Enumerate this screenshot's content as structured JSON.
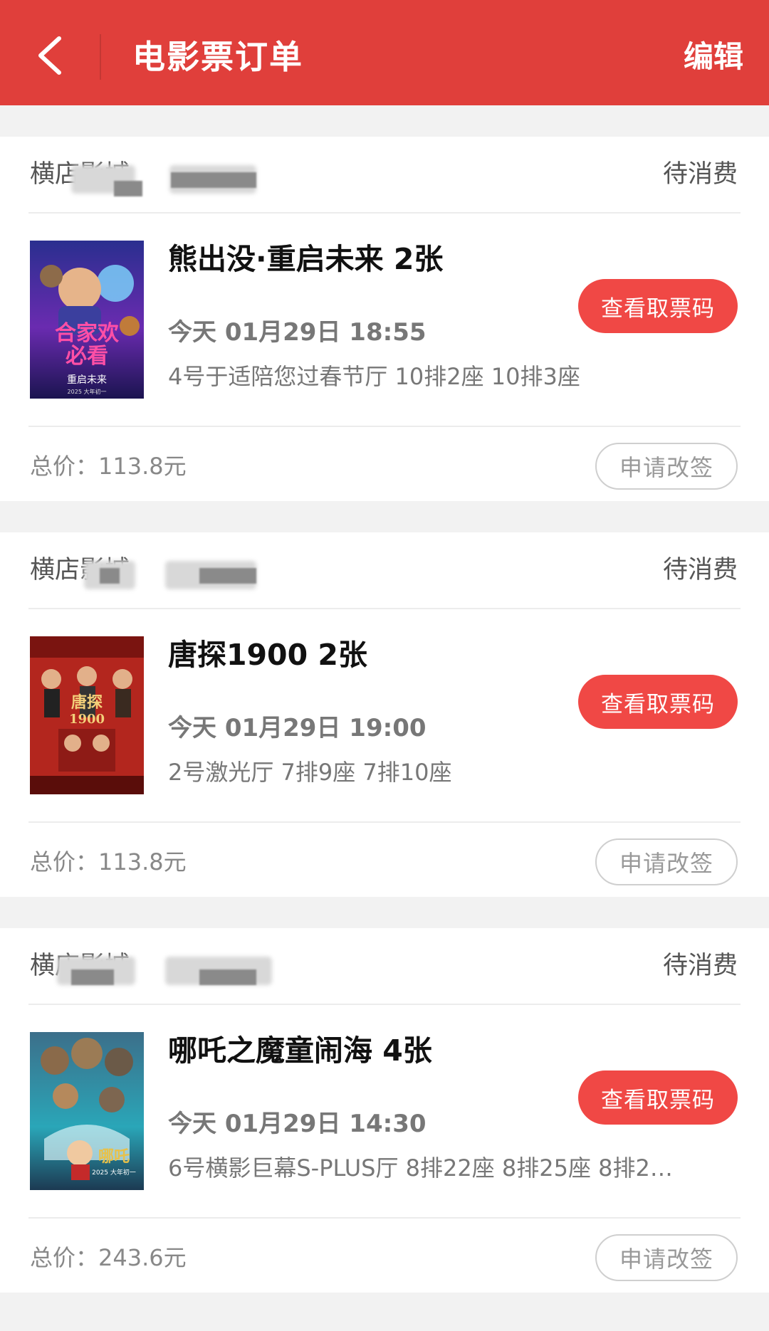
{
  "header": {
    "title": "电影票订单",
    "edit_label": "编辑"
  },
  "orders": [
    {
      "cinema": "横店影城",
      "status": "待消费",
      "movie": "熊出没·重启未来 2张",
      "showtime": "今天 01月29日 18:55",
      "seats": "4号于适陪您过春节厅 10排2座 10排3座",
      "ticket_button": "查看取票码",
      "total_label": "总价：",
      "total": "113.8元",
      "reschedule_button": "申请改签",
      "poster": {
        "text_1": "合家欢",
        "text_2": "必看",
        "text_3": "重启未来",
        "text_4": "2025 大年初一"
      }
    },
    {
      "cinema": "横店影城",
      "status": "待消费",
      "movie": "唐探1900 2张",
      "showtime": "今天 01月29日 19:00",
      "seats": "2号激光厅 7排9座 7排10座",
      "ticket_button": "查看取票码",
      "total_label": "总价：",
      "total": "113.8元",
      "reschedule_button": "申请改签",
      "poster": {
        "text_1": "唐探",
        "text_2": "1900"
      }
    },
    {
      "cinema": "横店影城",
      "status": "待消费",
      "movie": "哪吒之魔童闹海 4张",
      "showtime": "今天 01月29日 14:30",
      "seats": "6号横影巨幕S-PLUS厅 8排22座 8排25座 8排2…",
      "ticket_button": "查看取票码",
      "total_label": "总价：",
      "total": "243.6元",
      "reschedule_button": "申请改签",
      "poster": {
        "text_1": "哪吒",
        "text_2": "2025 大年初一"
      }
    }
  ],
  "colors": {
    "brand_red": "#e03f3b",
    "button_red": "#f04845"
  }
}
